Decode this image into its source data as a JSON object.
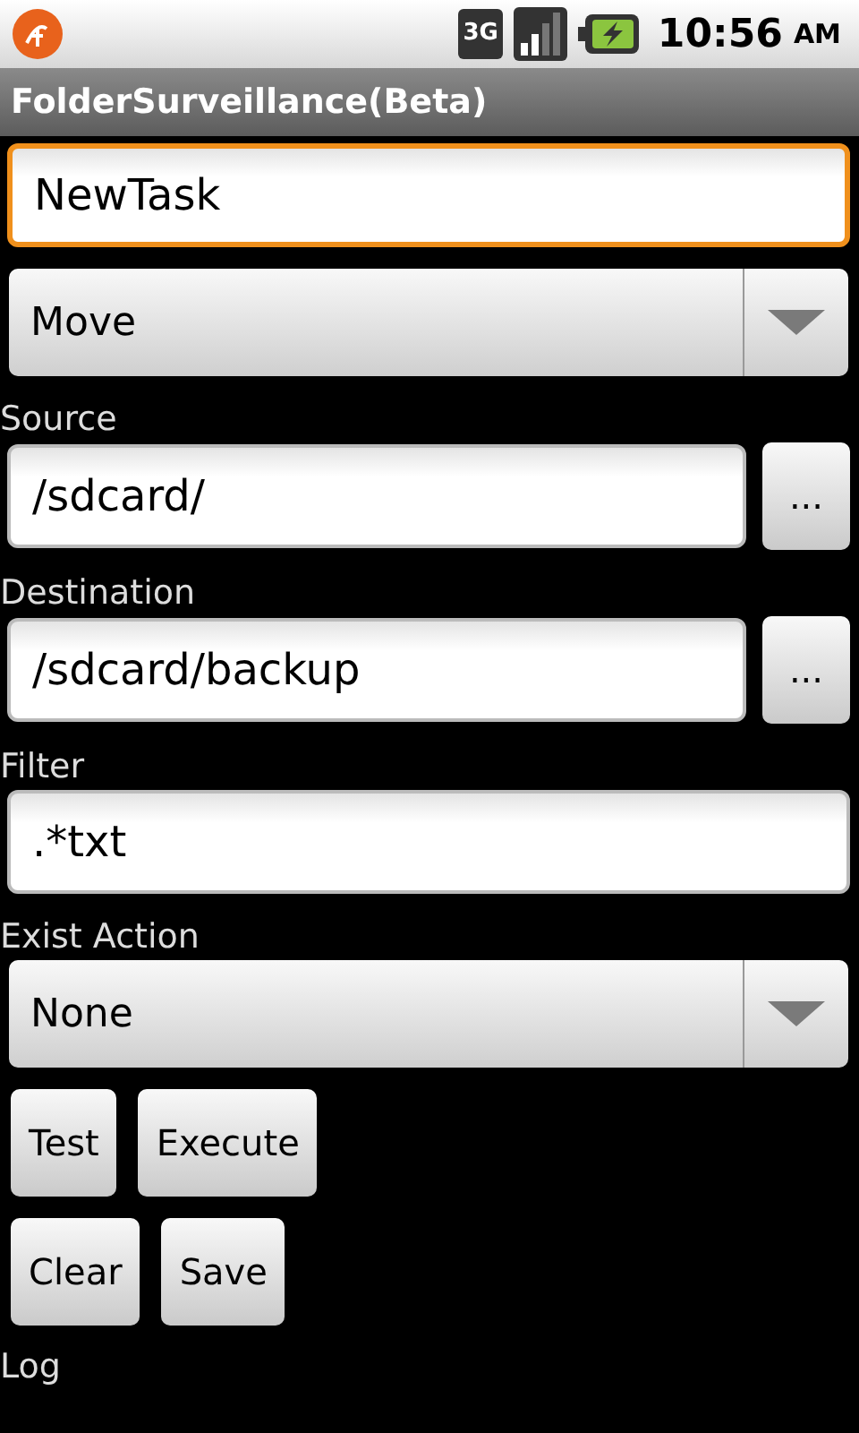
{
  "status_bar": {
    "network_type": "3G",
    "time": "10:56",
    "am_pm": "AM"
  },
  "title": "FolderSurveillance(Beta)",
  "task_name": {
    "value": "NewTask",
    "focused": true
  },
  "action": {
    "value": "Move"
  },
  "source": {
    "label": "Source",
    "value": "/sdcard/",
    "browse": "..."
  },
  "destination": {
    "label": "Destination",
    "value": "/sdcard/backup",
    "browse": "..."
  },
  "filter": {
    "label": "Filter",
    "value": ".*txt"
  },
  "exist_action": {
    "label": "Exist Action",
    "value": "None"
  },
  "button_rows": [
    [
      "Test",
      "Execute"
    ],
    [
      "Clear",
      "Save"
    ]
  ],
  "log_label": "Log"
}
